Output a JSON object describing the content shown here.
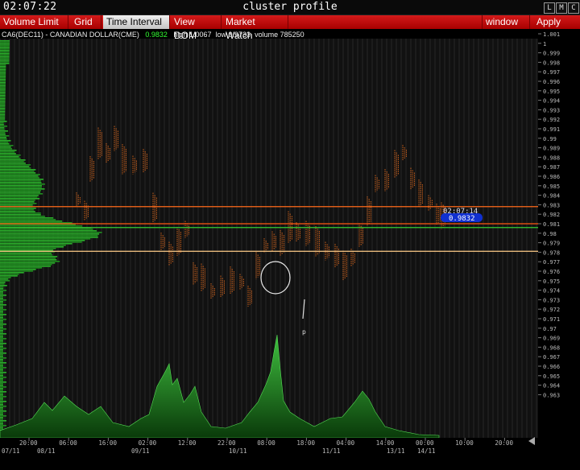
{
  "titlebar": {
    "clock": "02:07:22",
    "title": "cluster profile",
    "buttons": [
      "L",
      "M",
      "C"
    ]
  },
  "menu": {
    "items": [
      "Volume Limit",
      "Grid",
      "Time Interval",
      "View DOM",
      "Market Watch"
    ],
    "active": "Time Interval",
    "right": [
      "window",
      "Apply"
    ]
  },
  "instrument": {
    "name": "CA6(DEC11) - CANADIAN DOLLAR(CME)",
    "last": "0.9832",
    "high_label": "high",
    "high": "1.0067",
    "low_label": "low",
    "low": "0.9733",
    "volume_label": "volume",
    "volume": "785250"
  },
  "price_axis": [
    "1.001",
    "1",
    "0.999",
    "0.998",
    "0.997",
    "0.996",
    "0.995",
    "0.994",
    "0.993",
    "0.992",
    "0.991",
    "0.99",
    "0.989",
    "0.988",
    "0.987",
    "0.986",
    "0.985",
    "0.984",
    "0.983",
    "0.982",
    "0.981",
    "0.98",
    "0.979",
    "0.978",
    "0.977",
    "0.976",
    "0.975",
    "0.974",
    "0.973",
    "0.972",
    "0.971",
    "0.97",
    "0.969",
    "0.968",
    "0.967",
    "0.966",
    "0.965",
    "0.964",
    "0.963"
  ],
  "time_axis": {
    "times": [
      "20:00",
      "06:00",
      "16:00",
      "02:00",
      "12:00",
      "22:00",
      "08:00",
      "18:00",
      "04:00",
      "14:00",
      "00:00",
      "10:00",
      "20:00"
    ],
    "dates": [
      "07/11",
      "08/11",
      "09/11",
      "10/11",
      "11/11",
      "13/11",
      "14/11"
    ]
  },
  "cursor": {
    "time": "02:07:14",
    "price": "0.9832"
  },
  "levels": [
    {
      "price": 0.9828,
      "label": "0.9828",
      "flag": "P",
      "color": "#ff6a1a"
    },
    {
      "price": 0.981,
      "label": "0.981",
      "flag": "P",
      "color": "#ff5a10"
    },
    {
      "price": 0.9806,
      "label": "0.9806",
      "flag": "P",
      "color": "#33cc33"
    },
    {
      "price": 0.9781,
      "label": "0.9781",
      "flag": "P",
      "color": "#ffcc88"
    }
  ],
  "colors": {
    "menu_bg": "#c00000",
    "profile": "#22aa22",
    "bars": "#d0641e",
    "cursor_tag": "#1030d0",
    "volume_fill": "#1a7a1a"
  }
}
